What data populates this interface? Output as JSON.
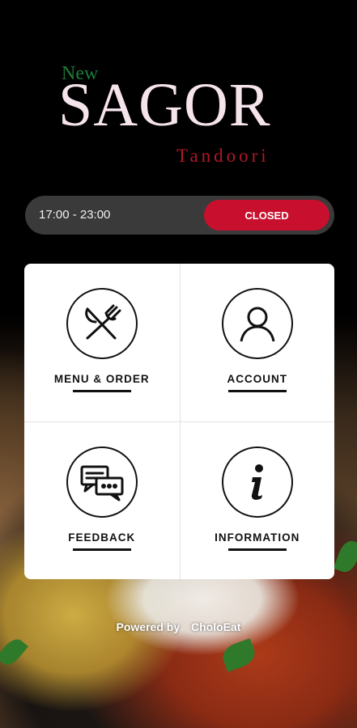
{
  "logo": {
    "new": "New",
    "name": "SAGOR",
    "sub": "Tandoori"
  },
  "hours": {
    "time": "17:00 - 23:00",
    "status": "CLOSED"
  },
  "menu": {
    "items": [
      {
        "label": "MENU & ORDER",
        "icon": "fork-knife-icon"
      },
      {
        "label": "ACCOUNT",
        "icon": "user-icon"
      },
      {
        "label": "FEEDBACK",
        "icon": "chat-icon"
      },
      {
        "label": "INFORMATION",
        "icon": "info-icon"
      }
    ]
  },
  "footer": {
    "powered_by": "Powered by",
    "brand": "CholoEat"
  },
  "colors": {
    "accent_red": "#c8102e",
    "logo_green": "#1f7a3a",
    "logo_pink": "#f6e4ec",
    "bar_dark": "#3a3a3a"
  }
}
